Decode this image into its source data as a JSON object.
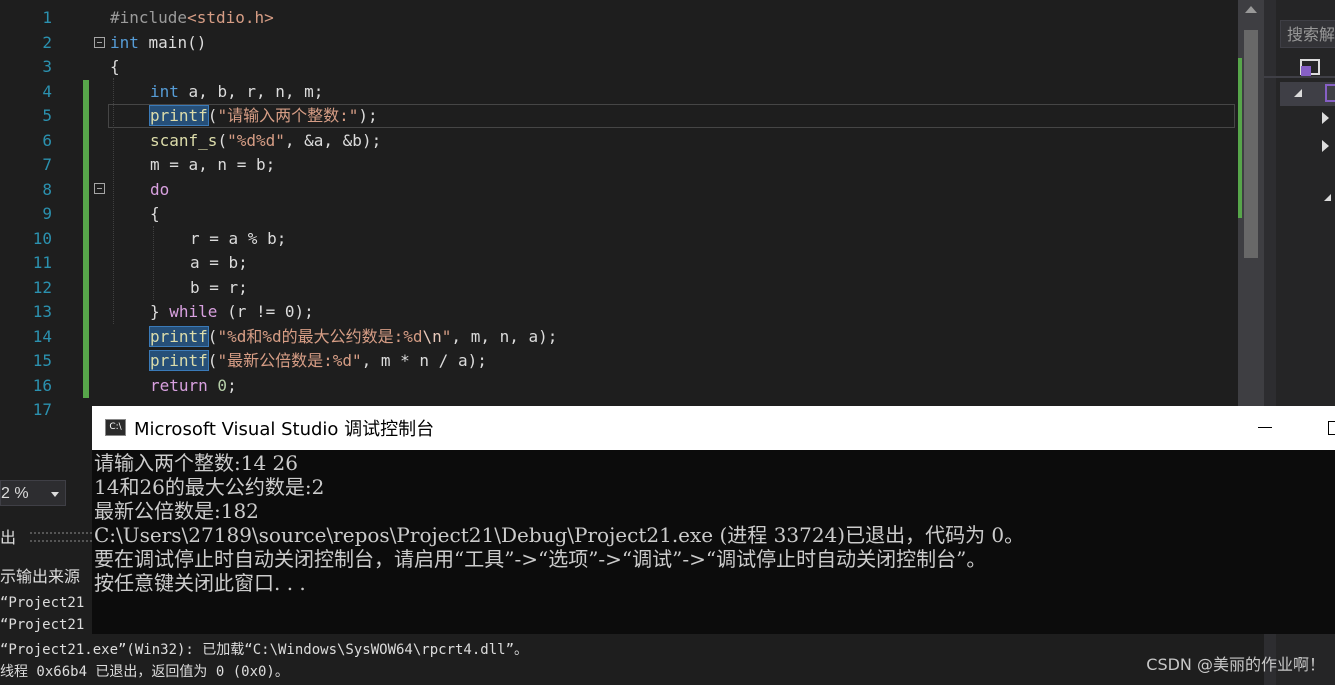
{
  "editor": {
    "line_numbers": [
      "1",
      "2",
      "3",
      "4",
      "5",
      "6",
      "7",
      "8",
      "9",
      "10",
      "11",
      "12",
      "13",
      "14",
      "15",
      "16",
      "17"
    ],
    "lines": {
      "l1_pp": "#include",
      "l1_inc": "<stdio.h>",
      "l2_kw": "int",
      "l2_rest": " main()",
      "l3": "{",
      "l4_kw": "int",
      "l4_rest": " a, b, r, n, m;",
      "l5_fn": "printf",
      "l5_open": "(",
      "l5_str": "\"请输入两个整数:\"",
      "l5_close": ");",
      "l6_fn": "scanf_s",
      "l6_open": "(",
      "l6_str": "\"%d%d\"",
      "l6_rest": ", &a, &b);",
      "l7": "m = a, n = b;",
      "l8_kw": "do",
      "l9": "{",
      "l10": "r = a % b;",
      "l11": "a = b;",
      "l12": "b = r;",
      "l13_brace": "} ",
      "l13_kw": "while",
      "l13_rest": " (r != 0);",
      "l14_fn": "printf",
      "l14_open": "(",
      "l14_str": "\"%d和%d的最大公约数是:%d",
      "l14_esc": "\\n",
      "l14_strend": "\"",
      "l14_rest": ", m, n, a);",
      "l15_fn": "printf",
      "l15_open": "(",
      "l15_str": "\"最新公倍数是:%d\"",
      "l15_rest": ", m * n / a);",
      "l16_kw": "return",
      "l16_num": " 0",
      "l16_end": ";"
    }
  },
  "search": {
    "placeholder": "搜索解"
  },
  "zoom": {
    "value": "2 %"
  },
  "output_panel": {
    "title": "出",
    "source_label": "示输出来源",
    "lines": [
      "“Project21",
      "“Project21",
      "“Project21.exe”(Win32): 已加载“C:\\Windows\\SysWOW64\\rpcrt4.dll”。",
      "线程 0x66b4 已退出，返回值为 0 (0x0)。"
    ]
  },
  "console": {
    "title": "Microsoft Visual Studio 调试控制台",
    "icon_text": "C:\\",
    "lines": [
      "请输入两个整数:14 26",
      "14和26的最大公约数是:2",
      "最新公倍数是:182",
      "C:\\Users\\27189\\source\\repos\\Project21\\Debug\\Project21.exe (进程 33724)已退出，代码为 0。",
      "要在调试停止时自动关闭控制台，请启用“工具”->“选项”->“调试”->“调试停止时自动关闭控制台”。",
      "按任意键关闭此窗口. . ."
    ]
  },
  "watermark": "CSDN @美丽的作业啊！",
  "colors": {
    "background": "#1e1e1e",
    "keyword": "#569cd6",
    "control": "#d8a0df",
    "function": "#dcdcaa",
    "string": "#d69d85",
    "line_number": "#2b91af",
    "change_bar": "#57a64a"
  }
}
